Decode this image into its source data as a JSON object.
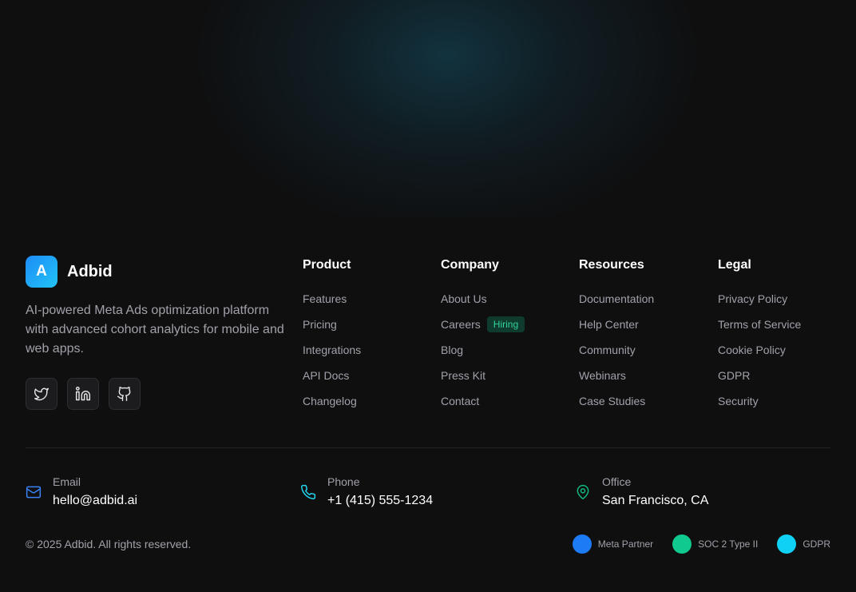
{
  "brand": {
    "logo_letter": "A",
    "name": "Adbid",
    "tagline": "AI-powered Meta Ads optimization platform with advanced cohort analytics for mobile and web apps."
  },
  "socials": [
    {
      "icon": "twitter-icon"
    },
    {
      "icon": "linkedin-icon"
    },
    {
      "icon": "github-icon"
    }
  ],
  "columns": {
    "product": {
      "title": "Product",
      "links": [
        "Features",
        "Pricing",
        "Integrations",
        "API Docs",
        "Changelog"
      ]
    },
    "company": {
      "title": "Company",
      "links": [
        "About Us",
        "Careers",
        "Blog",
        "Press Kit",
        "Contact"
      ],
      "careers_badge": "Hiring"
    },
    "resources": {
      "title": "Resources",
      "links": [
        "Documentation",
        "Help Center",
        "Community",
        "Webinars",
        "Case Studies"
      ]
    },
    "legal": {
      "title": "Legal",
      "links": [
        "Privacy Policy",
        "Terms of Service",
        "Cookie Policy",
        "GDPR",
        "Security"
      ]
    }
  },
  "contact": {
    "email": {
      "label": "Email",
      "value": "hello@adbid.ai",
      "icon": "mail-icon",
      "color": "#3b82f6"
    },
    "phone": {
      "label": "Phone",
      "value": "+1 (415) 555-1234",
      "icon": "phone-icon",
      "color": "#22d3ee"
    },
    "office": {
      "label": "Office",
      "value": "San Francisco, CA",
      "icon": "map-pin-icon",
      "color": "#10b981"
    }
  },
  "copyright": "© 2025 Adbid. All rights reserved.",
  "certifications": [
    {
      "label": "Meta Partner",
      "color": "#1d7bf5"
    },
    {
      "label": "SOC 2 Type II",
      "color": "#10c98f"
    },
    {
      "label": "GDPR",
      "color": "#0fd0f5"
    }
  ],
  "colors": {
    "background": "#0f0f10",
    "badge_bg": "#0f3b2f",
    "badge_text": "#34d399"
  }
}
